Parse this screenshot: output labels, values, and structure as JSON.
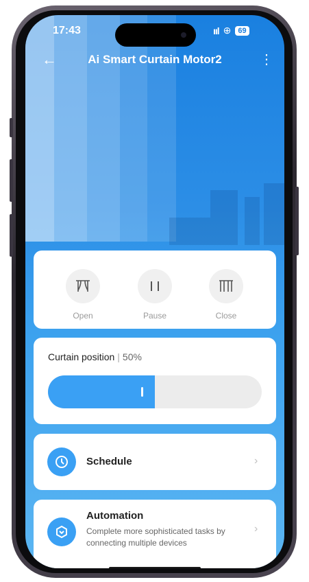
{
  "status_bar": {
    "time": "17:43",
    "signal": "ııl",
    "battery": "69"
  },
  "header": {
    "title": "Ai Smart Curtain Motor2"
  },
  "controls": [
    {
      "label": "Open",
      "icon": "curtain-open-icon"
    },
    {
      "label": "Pause",
      "icon": "pause-icon"
    },
    {
      "label": "Close",
      "icon": "curtain-close-icon"
    }
  ],
  "curtain_position": {
    "label": "Curtain position",
    "value_text": "50%",
    "value": 0.5
  },
  "schedule": {
    "title": "Schedule"
  },
  "automation": {
    "title": "Automation",
    "description": "Complete more sophisticated tasks by connecting multiple devices"
  },
  "colors": {
    "accent": "#3aa0f4",
    "background_top": "#1a80e0"
  }
}
